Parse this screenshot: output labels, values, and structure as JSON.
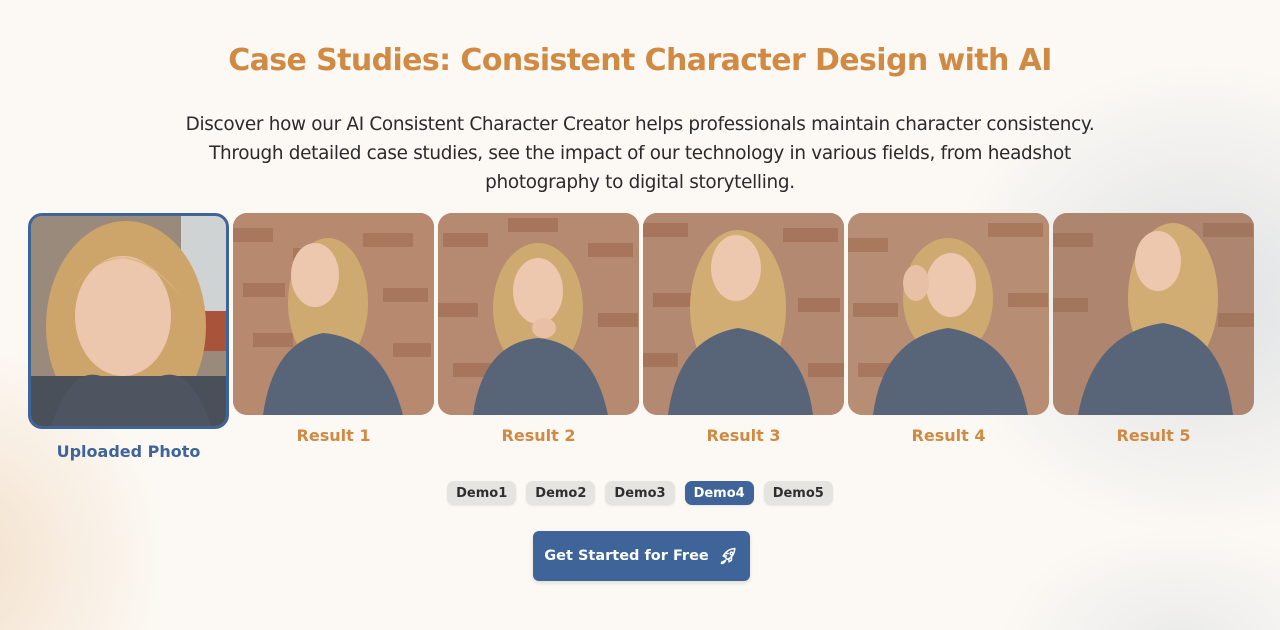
{
  "header": {
    "title": "Case Studies: Consistent Character Design with AI",
    "description": "Discover how our AI Consistent Character Creator helps professionals maintain character consistency. Through detailed case studies, see the impact of our technology in various fields, from headshot photography to digital storytelling."
  },
  "gallery": {
    "uploaded_label": "Uploaded Photo",
    "results": [
      {
        "label": "Result 1"
      },
      {
        "label": "Result 2"
      },
      {
        "label": "Result 3"
      },
      {
        "label": "Result 4"
      },
      {
        "label": "Result 5"
      }
    ]
  },
  "demos": {
    "tabs": [
      "Demo1",
      "Demo2",
      "Demo3",
      "Demo4",
      "Demo5"
    ],
    "active": "Demo4"
  },
  "cta": {
    "label": "Get Started for Free",
    "icon": "rocket-icon"
  },
  "colors": {
    "accent": "#d08a44",
    "primary": "#3e6499",
    "tab_bg": "#e6e4e1"
  }
}
